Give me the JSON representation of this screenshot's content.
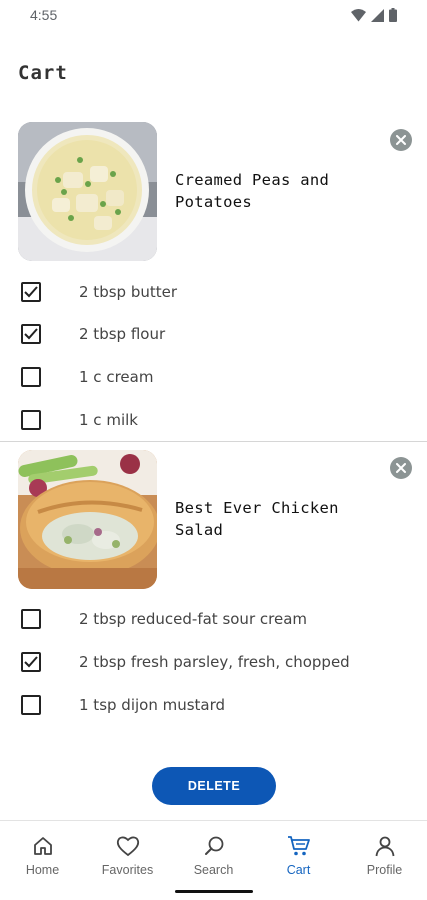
{
  "status_bar": {
    "time": "4:55"
  },
  "page": {
    "title": "Cart"
  },
  "recipes": [
    {
      "title": "Creamed Peas and Potatoes",
      "ingredients": [
        {
          "label": "2 tbsp butter",
          "checked": true
        },
        {
          "label": "2 tbsp flour",
          "checked": true
        },
        {
          "label": "1 c cream",
          "checked": false
        },
        {
          "label": "1 c milk",
          "checked": false
        }
      ]
    },
    {
      "title": "Best Ever Chicken Salad",
      "ingredients": [
        {
          "label": "2 tbsp reduced-fat sour cream",
          "checked": false
        },
        {
          "label": "2 tbsp fresh parsley, fresh, chopped",
          "checked": true
        },
        {
          "label": "1 tsp dijon mustard",
          "checked": false
        }
      ]
    }
  ],
  "actions": {
    "delete_label": "DELETE"
  },
  "nav": {
    "items": [
      {
        "label": "Home",
        "icon": "home-icon",
        "active": false
      },
      {
        "label": "Favorites",
        "icon": "heart-icon",
        "active": false
      },
      {
        "label": "Search",
        "icon": "search-icon",
        "active": false
      },
      {
        "label": "Cart",
        "icon": "cart-icon",
        "active": true
      },
      {
        "label": "Profile",
        "icon": "person-icon",
        "active": false
      }
    ]
  },
  "colors": {
    "accent": "#0d57b5",
    "nav_active": "#1565c0",
    "remove_icon_bg": "#8c9494"
  }
}
